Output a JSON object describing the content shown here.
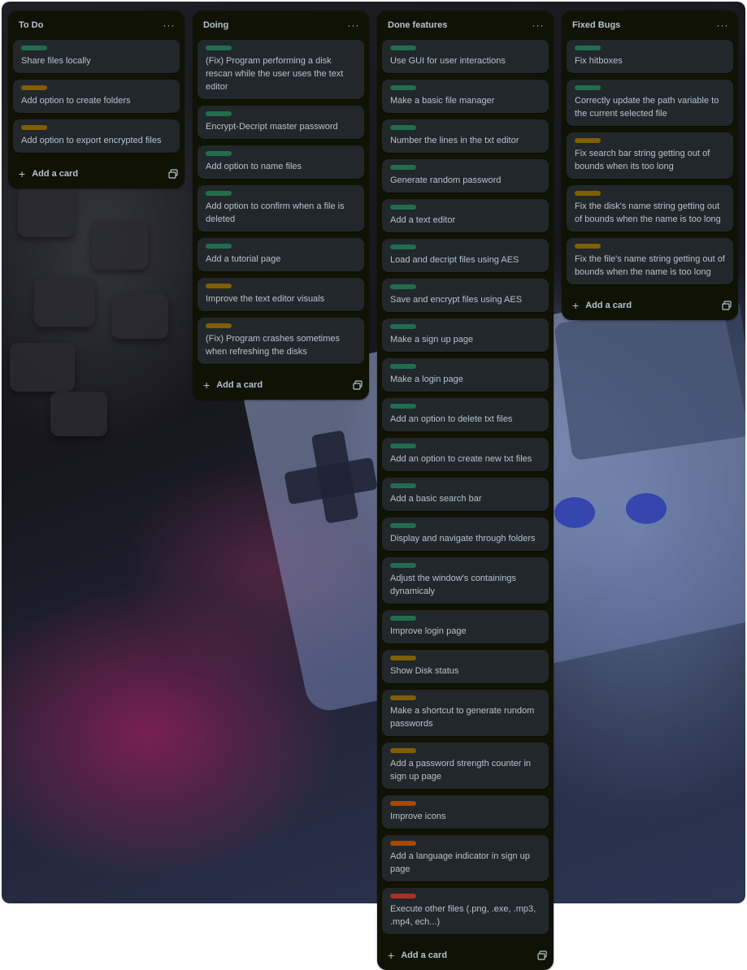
{
  "colors": {
    "green": "#216e4e",
    "yellow": "#7f5f01",
    "orange": "#a54800",
    "red": "#ae2e24"
  },
  "icons": {
    "menu": "more-horizontal-icon",
    "add": "plus-icon",
    "template": "card-template-icon"
  },
  "lists": [
    {
      "title": "To Do",
      "menu": "···",
      "add_label": "Add a card",
      "add_symbol": "+",
      "cards": [
        {
          "label": "green",
          "text": "Share files locally"
        },
        {
          "label": "yellow",
          "text": "Add option to create folders"
        },
        {
          "label": "yellow",
          "text": "Add option to export encrypted files"
        }
      ]
    },
    {
      "title": "Doing",
      "menu": "···",
      "add_label": "Add a card",
      "add_symbol": "+",
      "cards": [
        {
          "label": "green",
          "text": "(Fix) Program performing a disk rescan while the user uses the text editor"
        },
        {
          "label": "green",
          "text": "Encrypt-Decript master password"
        },
        {
          "label": "green",
          "text": "Add option to name files"
        },
        {
          "label": "green",
          "text": "Add option to confirm when a file is deleted"
        },
        {
          "label": "green",
          "text": "Add a tutorial page"
        },
        {
          "label": "yellow",
          "text": "Improve the text editor visuals"
        },
        {
          "label": "yellow",
          "text": "(Fix) Program crashes sometimes when refreshing the disks"
        }
      ]
    },
    {
      "title": "Done features",
      "menu": "···",
      "add_label": "Add a card",
      "add_symbol": "+",
      "cards": [
        {
          "label": "green",
          "text": "Use GUI for user interactions"
        },
        {
          "label": "green",
          "text": "Make a basic file manager"
        },
        {
          "label": "green",
          "text": "Number the lines in the txt editor"
        },
        {
          "label": "green",
          "text": "Generate random password"
        },
        {
          "label": "green",
          "text": "Add a text editor"
        },
        {
          "label": "green",
          "text": "Load and decript files using AES"
        },
        {
          "label": "green",
          "text": "Save and encrypt files using AES"
        },
        {
          "label": "green",
          "text": "Make a sign up page"
        },
        {
          "label": "green",
          "text": "Make a login page"
        },
        {
          "label": "green",
          "text": "Add an option to delete txt files"
        },
        {
          "label": "green",
          "text": "Add an option to create new txt files"
        },
        {
          "label": "green",
          "text": "Add a basic search bar"
        },
        {
          "label": "green",
          "text": "Display and navigate through folders"
        },
        {
          "label": "green",
          "text": "Adjust the window's containings dynamicaly"
        },
        {
          "label": "green",
          "text": "Improve login page"
        },
        {
          "label": "yellow",
          "text": "Show Disk status"
        },
        {
          "label": "yellow",
          "text": "Make a shortcut to generate rundom passwords"
        },
        {
          "label": "yellow",
          "text": "Add a password strength counter in sign up page"
        },
        {
          "label": "orange",
          "text": "Improve icons"
        },
        {
          "label": "orange",
          "text": "Add a language indicator in sign up page"
        },
        {
          "label": "red",
          "text": "Execute other files (.png, .exe, .mp3, .mp4, ech...)"
        }
      ]
    },
    {
      "title": "Fixed Bugs",
      "menu": "···",
      "add_label": "Add a card",
      "add_symbol": "+",
      "cards": [
        {
          "label": "green",
          "text": "Fix hitboxes"
        },
        {
          "label": "green",
          "text": "Correctly update the path variable to the current selected file"
        },
        {
          "label": "yellow",
          "text": "Fix search bar string getting out of bounds when its too long"
        },
        {
          "label": "yellow",
          "text": "Fix the disk's name string getting out of bounds when the name is too long"
        },
        {
          "label": "yellow",
          "text": "Fix the file's name string getting out of bounds when the name is too long"
        }
      ]
    }
  ]
}
